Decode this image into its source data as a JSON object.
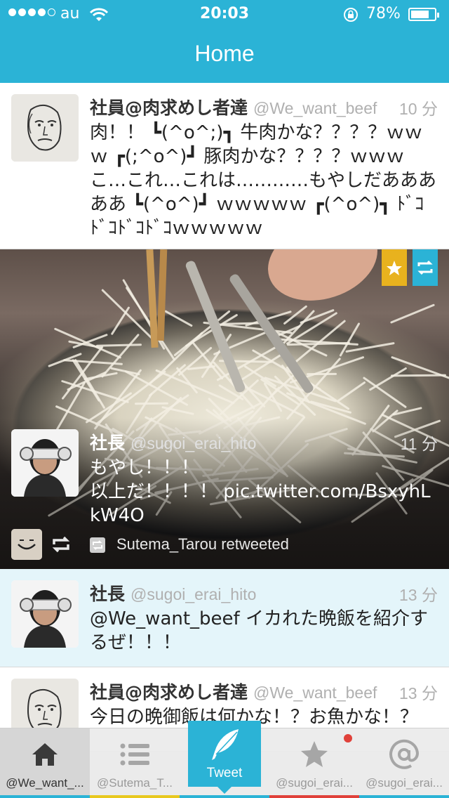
{
  "status_bar": {
    "carrier": "au",
    "time": "20:03",
    "battery_percent": "78%",
    "battery_level": 0.78,
    "signal_bars_filled": 4,
    "signal_bars_total": 5
  },
  "nav": {
    "title": "Home"
  },
  "tweets": [
    {
      "name": "社員@肉求めし者達",
      "handle": "@We_want_beef",
      "time": "10 分",
      "text": "肉！！ ┗(^o^;)┓ 牛肉かな？？？？ｗｗｗ ┏(;^o^)┛ 豚肉かな？？？？ｗｗｗ こ…これ…これは…………もやしだあああああ ┗(^o^)┛ ｗｗｗｗｗ ┏(^o^)┓ ﾄﾞｺﾄﾞｺﾄﾞｺﾄﾞｺｗｗｗｗｗ"
    },
    {
      "name": "社長",
      "handle": "@sugoi_erai_hito",
      "time": "11 分",
      "text": "もやし！！！\n以上だ！！！！ pic.twitter.com/BsxyhLkW4O",
      "retweeted_by": "Sutema_Tarou retweeted"
    },
    {
      "name": "社長",
      "handle": "@sugoi_erai_hito",
      "time": "13 分",
      "text": "@We_want_beef イカれた晩飯を紹介するぜ！！！"
    },
    {
      "name": "社員@肉求めし者達",
      "handle": "@We_want_beef",
      "time": "13 分",
      "text": "今日の晩御飯は何かな！？お魚かな！？"
    }
  ],
  "tabs": [
    {
      "label": "@We_want_...",
      "icon": "home-icon",
      "accent": "#2bb3d6"
    },
    {
      "label": "@Sutema_T...",
      "icon": "list-icon",
      "accent": "#e8c81e"
    },
    {
      "label": "Tweet",
      "icon": "feather-icon",
      "accent": "#2bb3d6"
    },
    {
      "label": "@sugoi_erai...",
      "icon": "star-icon",
      "accent": "#e0413a"
    },
    {
      "label": "@sugoi_erai...",
      "icon": "mention-icon",
      "accent": "#2bb3d6"
    }
  ],
  "colors": {
    "accent": "#2bb3d6",
    "favorite_ribbon": "#e8b21e",
    "retweet_ribbon": "#2bb3d6",
    "notification_dot": "#e0413a"
  }
}
